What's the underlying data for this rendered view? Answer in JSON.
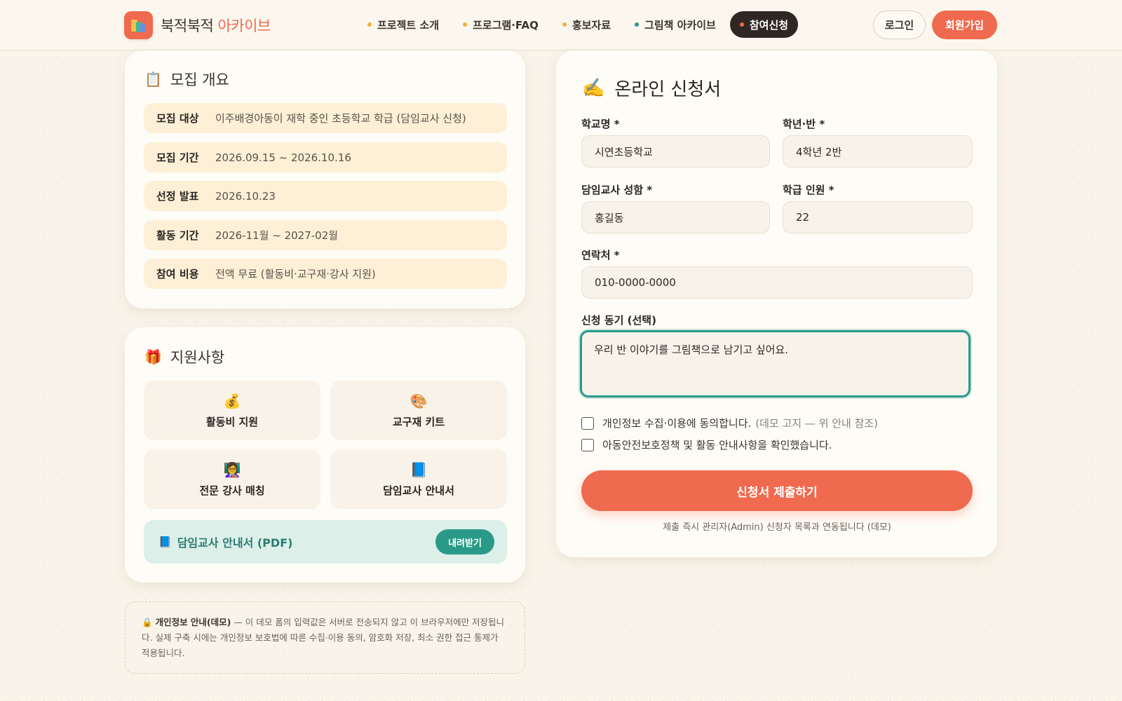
{
  "header": {
    "logo_main": "북적북적 ",
    "logo_accent": "아카이브",
    "nav": [
      {
        "label": "프로젝트 소개",
        "dot": "#f2b03a"
      },
      {
        "label": "프로그램·FAQ",
        "dot": "#f2b03a"
      },
      {
        "label": "홍보자료",
        "dot": "#f2b03a"
      },
      {
        "label": "그림책 아카이브",
        "dot": "#2a9a88"
      },
      {
        "label": "참여신청",
        "dot": "#ef6a4e"
      }
    ],
    "login": "로그인",
    "join": "회원가입"
  },
  "overview": {
    "icon": "📋",
    "title": "모집 개요",
    "rows": [
      {
        "k": "모집 대상",
        "v": "이주배경아동이 재학 중인 초등학교 학급 (담임교사 신청)"
      },
      {
        "k": "모집 기간",
        "v": "2026.09.15 ~ 2026.10.16"
      },
      {
        "k": "선정 발표",
        "v": "2026.10.23"
      },
      {
        "k": "활동 기간",
        "v": "2026-11월 ~ 2027-02월"
      },
      {
        "k": "참여 비용",
        "v": "전액 무료 (활동비·교구재·강사 지원)"
      }
    ]
  },
  "support": {
    "icon": "🎁",
    "title": "지원사항",
    "tiles": [
      {
        "icon": "💰",
        "label": "활동비 지원"
      },
      {
        "icon": "🎨",
        "label": "교구재 키트"
      },
      {
        "icon": "👩‍🏫",
        "label": "전문 강사 매칭"
      },
      {
        "icon": "📘",
        "label": "담임교사 안내서"
      }
    ],
    "pdf_icon": "📘",
    "pdf_label": "담임교사 안내서 (PDF)",
    "download": "내려받기"
  },
  "privacy": {
    "icon": "🔒",
    "title": "개인정보 안내(데모)",
    "body": " — 이 데모 폼의 입력값은 서버로 전송되지 않고 이 브라우저에만 저장됩니다. 실제 구축 시에는 개인정보 보호법에 따른 수집·이용 동의, 암호화 저장, 최소 권한 접근 통제가 적용됩니다."
  },
  "form": {
    "icon": "✍️",
    "title": "온라인 신청서",
    "school_label": "학교명 *",
    "school_value": "시연초등학교",
    "class_label": "학년·반 *",
    "class_value": "4학년 2반",
    "teacher_label": "담임교사 성함 *",
    "teacher_value": "홍길동",
    "count_label": "학급 인원 *",
    "count_value": "22",
    "phone_label": "연락처 *",
    "phone_value": "010-0000-0000",
    "motive_label": "신청 동기 (선택)",
    "motive_value": "우리 반 이야기를 그림책으로 남기고 싶어요.",
    "consent1": "개인정보 수집·이용에 동의합니다.",
    "consent1_note": "(데모 고지 — 위 안내 참조)",
    "consent2": "아동안전보호정책 및 활동 안내사항을 확인했습니다.",
    "submit": "신청서 제출하기",
    "note": "제출 즉시 관리자(Admin) 신청자 목록과 연동됩니다 (데모)"
  }
}
